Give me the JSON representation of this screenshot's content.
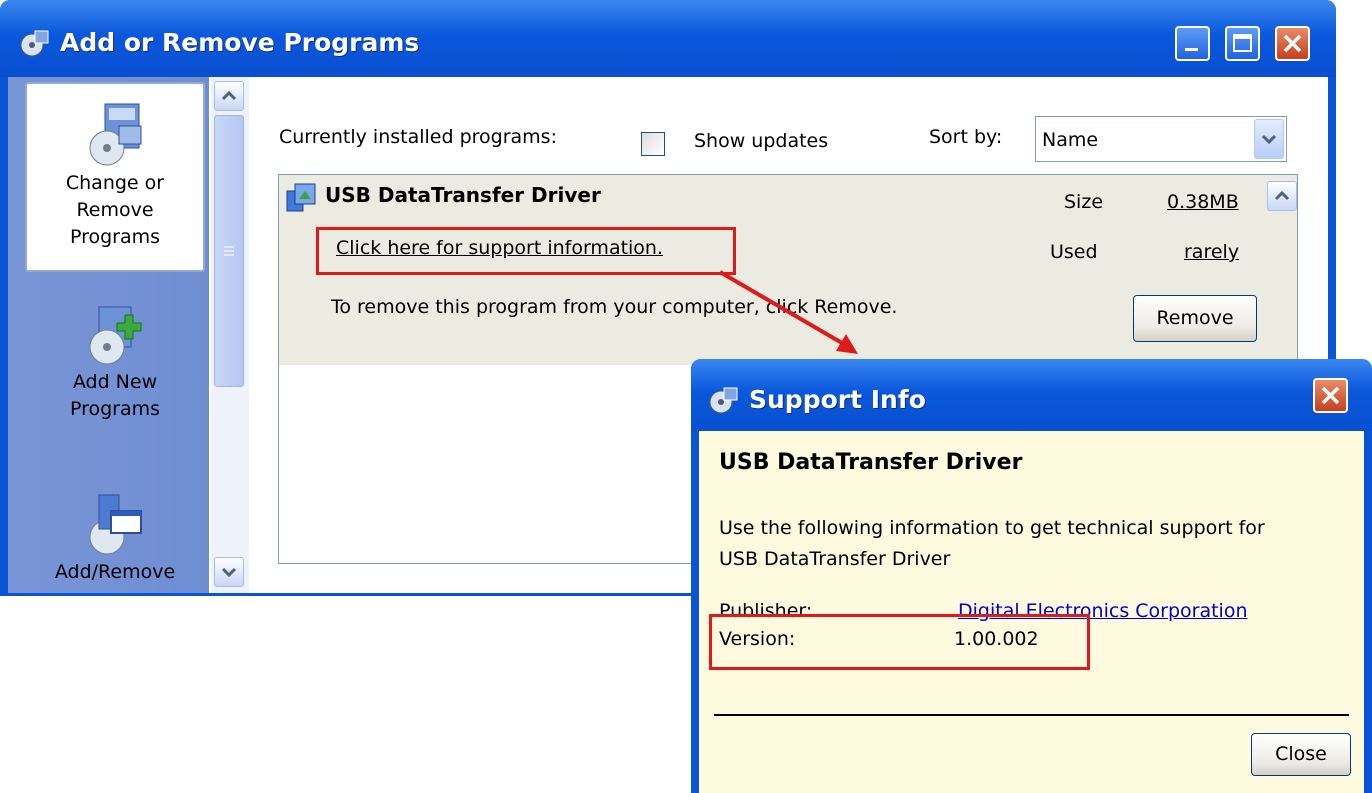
{
  "window": {
    "title": "Add or Remove Programs",
    "controls": [
      "minimize",
      "maximize",
      "close"
    ]
  },
  "sidebar": {
    "items": [
      {
        "label_lines": [
          "Change or",
          "Remove",
          "Programs"
        ],
        "icon": "change-remove-programs-icon",
        "active": true
      },
      {
        "label_lines": [
          "Add New",
          "Programs"
        ],
        "icon": "add-new-programs-icon",
        "active": false
      },
      {
        "label_lines": [
          "Add/Remove"
        ],
        "icon": "add-remove-components-icon",
        "active": false
      }
    ]
  },
  "toolbar": {
    "installed_label": "Currently installed programs:",
    "show_updates_label": "Show updates",
    "show_updates_checked": false,
    "sort_label": "Sort by:",
    "sort_value": "Name"
  },
  "program": {
    "name": "USB DataTransfer Driver",
    "support_link": "Click here for support information.",
    "size_label": "Size",
    "size_value": "0.38MB",
    "used_label": "Used",
    "used_value": "rarely",
    "remove_text": "To remove this program from your computer, click Remove.",
    "remove_button": "Remove"
  },
  "dialog": {
    "title": "Support Info",
    "program_name": "USB DataTransfer Driver",
    "description_line1": "Use the following information to get technical support for",
    "description_line2": "USB DataTransfer Driver",
    "publisher_label": "Publisher:",
    "publisher_value": "Digital Electronics Corporation",
    "version_label": "Version:",
    "version_value": "1.00.002",
    "close_button": "Close"
  },
  "colors": {
    "titlebar_blue": "#0a55d6",
    "highlight_red": "#e0191b",
    "selected_row": "#ecebe2",
    "dialog_body": "#fdfae0",
    "link": "#0000cc"
  }
}
